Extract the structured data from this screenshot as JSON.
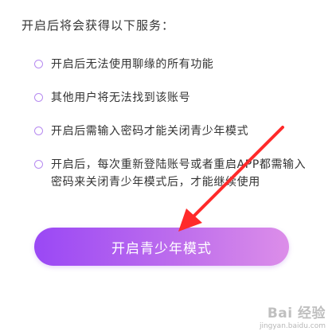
{
  "heading": "开启后将会获得以下服务：",
  "items": [
    "开启后无法使用聊缘的所有功能",
    "其他用户将无法找到该账号",
    "开启后需输入密码才能关闭青少年模式",
    "开启后，每次重新登陆账号或者重启APP都需输入密码来关闭青少年模式后，才能继续使用"
  ],
  "button": {
    "label": "开启青少年模式"
  },
  "watermark": {
    "brand": "Bai 经验",
    "url": "jingyan.baidu.com"
  },
  "colors": {
    "accent_start": "#9a48f5",
    "accent_end": "#dc8ee9",
    "bullet": "#b68af0",
    "annotation_arrow": "#ff2a2a"
  }
}
